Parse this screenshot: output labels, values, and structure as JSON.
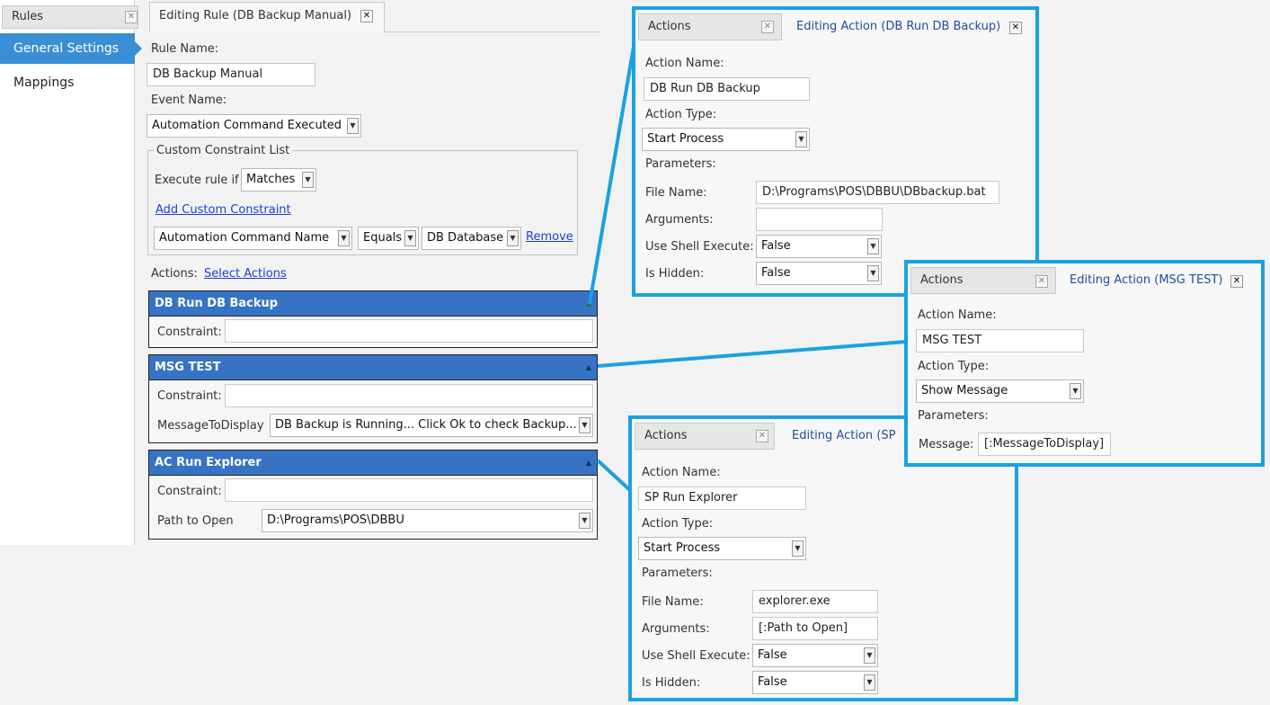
{
  "sidebar": {
    "tab_label": "Rules",
    "items": [
      {
        "label": "General Settings",
        "active": true
      },
      {
        "label": "Mappings",
        "active": false
      }
    ]
  },
  "main": {
    "tab_label": "Editing Rule (DB Backup Manual)",
    "rule_name_label": "Rule Name:",
    "rule_name_value": "DB Backup Manual",
    "event_name_label": "Event Name:",
    "event_name_value": "Automation Command Executed",
    "constraint_group": {
      "legend": "Custom Constraint List",
      "execute_label": "Execute rule if",
      "execute_value": "Matches",
      "add_link": "Add Custom Constraint",
      "constraint_field": "Automation Command Name",
      "constraint_operator": "Equals",
      "constraint_value": "DB Database",
      "remove_link": "Remove"
    },
    "actions_label": "Actions:",
    "select_actions_link": "Select Actions",
    "actions": [
      {
        "title": "DB Run DB Backup",
        "constraint_label": "Constraint:",
        "constraint_value": ""
      },
      {
        "title": "MSG TEST",
        "constraint_label": "Constraint:",
        "constraint_value": "",
        "param_label": "MessageToDisplay",
        "param_value": "DB Backup is Running... Click Ok to check Backup..."
      },
      {
        "title": "AC Run Explorer",
        "constraint_label": "Constraint:",
        "constraint_value": "",
        "param_label": "Path to Open",
        "param_value": "D:\\Programs\\POS\\DBBU"
      }
    ]
  },
  "panel1": {
    "tab_actions": "Actions",
    "tab_editing": "Editing Action (DB Run DB Backup)",
    "action_name_label": "Action Name:",
    "action_name_value": "DB Run DB Backup",
    "action_type_label": "Action Type:",
    "action_type_value": "Start Process",
    "parameters_label": "Parameters:",
    "file_name_label": "File Name:",
    "file_name_value": "D:\\Programs\\POS\\DBBU\\DBbackup.bat",
    "arguments_label": "Arguments:",
    "arguments_value": "",
    "use_shell_label": "Use Shell Execute:",
    "use_shell_value": "False",
    "is_hidden_label": "Is Hidden:",
    "is_hidden_value": "False"
  },
  "panel2": {
    "tab_actions": "Actions",
    "tab_editing": "Editing Action (MSG TEST)",
    "action_name_label": "Action Name:",
    "action_name_value": "MSG TEST",
    "action_type_label": "Action Type:",
    "action_type_value": "Show Message",
    "parameters_label": "Parameters:",
    "message_label": "Message:",
    "message_value": "[:MessageToDisplay]"
  },
  "panel3": {
    "tab_actions": "Actions",
    "tab_editing": "Editing Action (SP",
    "action_name_label": "Action Name:",
    "action_name_value": "SP Run Explorer",
    "action_type_label": "Action Type:",
    "action_type_value": "Start Process",
    "parameters_label": "Parameters:",
    "file_name_label": "File Name:",
    "file_name_value": "explorer.exe",
    "arguments_label": "Arguments:",
    "arguments_value": "[:Path to Open]",
    "use_shell_label": "Use Shell Execute:",
    "use_shell_value": "False",
    "is_hidden_label": "Is Hidden:",
    "is_hidden_value": "False"
  },
  "colors": {
    "accent": "#3a8fd4",
    "header_blue": "#3673c5",
    "callout": "#1aa1e0",
    "link": "#1a3fd6"
  },
  "icons": {
    "close": "close-icon",
    "dropdown": "chevron-down-icon",
    "collapse": "collapse-triangle-icon"
  }
}
